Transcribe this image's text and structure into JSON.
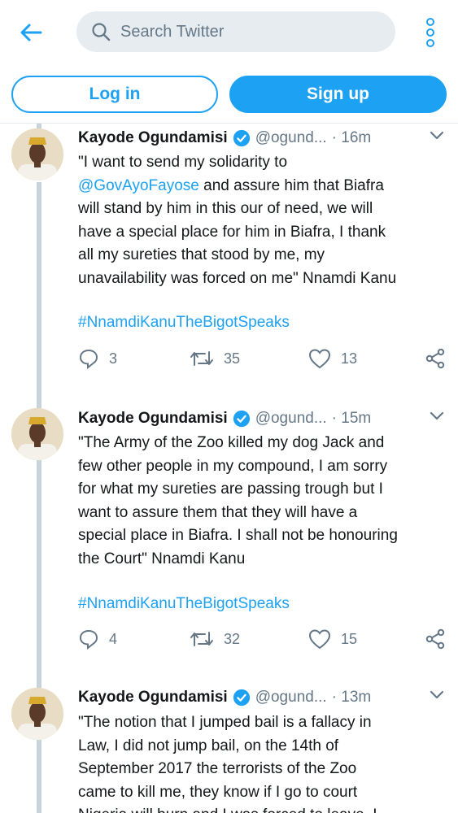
{
  "header": {
    "search_placeholder": "Search Twitter",
    "login_label": "Log in",
    "signup_label": "Sign up"
  },
  "colors": {
    "accent": "#1da1f2",
    "muted": "#657786",
    "divider": "#e6ecf0"
  },
  "tweets": [
    {
      "name": "Kayode Ogundamisi",
      "handle": "@ogund...",
      "time": "· 16m",
      "lines": [
        "\"I want to send my solidarity to",
        "@GovAyoFayose",
        " and assure him that Biafra",
        "will stand by him in this our of need, we will",
        "have a special place for him in Biafra, I thank",
        "all my sureties that stood by me, my",
        "unavailability was forced on me\" Nnamdi Kanu"
      ],
      "hashtag": "#NnamdiKanuTheBigotSpeaks",
      "replies": "3",
      "retweets": "35",
      "likes": "13"
    },
    {
      "name": "Kayode Ogundamisi",
      "handle": "@ogund...",
      "time": "· 15m",
      "lines": [
        "\"The Army of the Zoo killed my dog Jack and",
        "few other people in my compound, I am sorry",
        "for what my sureties are passing trough but I",
        "want to assure them that they will have a",
        "special place in Biafra. I shall not be honouring",
        "the Court\"  Nnamdi Kanu"
      ],
      "hashtag": "#NnamdiKanuTheBigotSpeaks",
      "replies": "4",
      "retweets": "32",
      "likes": "15"
    },
    {
      "name": "Kayode Ogundamisi",
      "handle": "@ogund...",
      "time": "· 13m",
      "lines": [
        "\"The notion that I jumped bail is a fallacy in",
        "Law, I did not jump bail, on the 14th of",
        "September 2017 the terrorists of the Zoo",
        "came to kill me, they know if I go to court",
        "Nigeria will burn and I was forced to leave. I"
      ]
    }
  ]
}
